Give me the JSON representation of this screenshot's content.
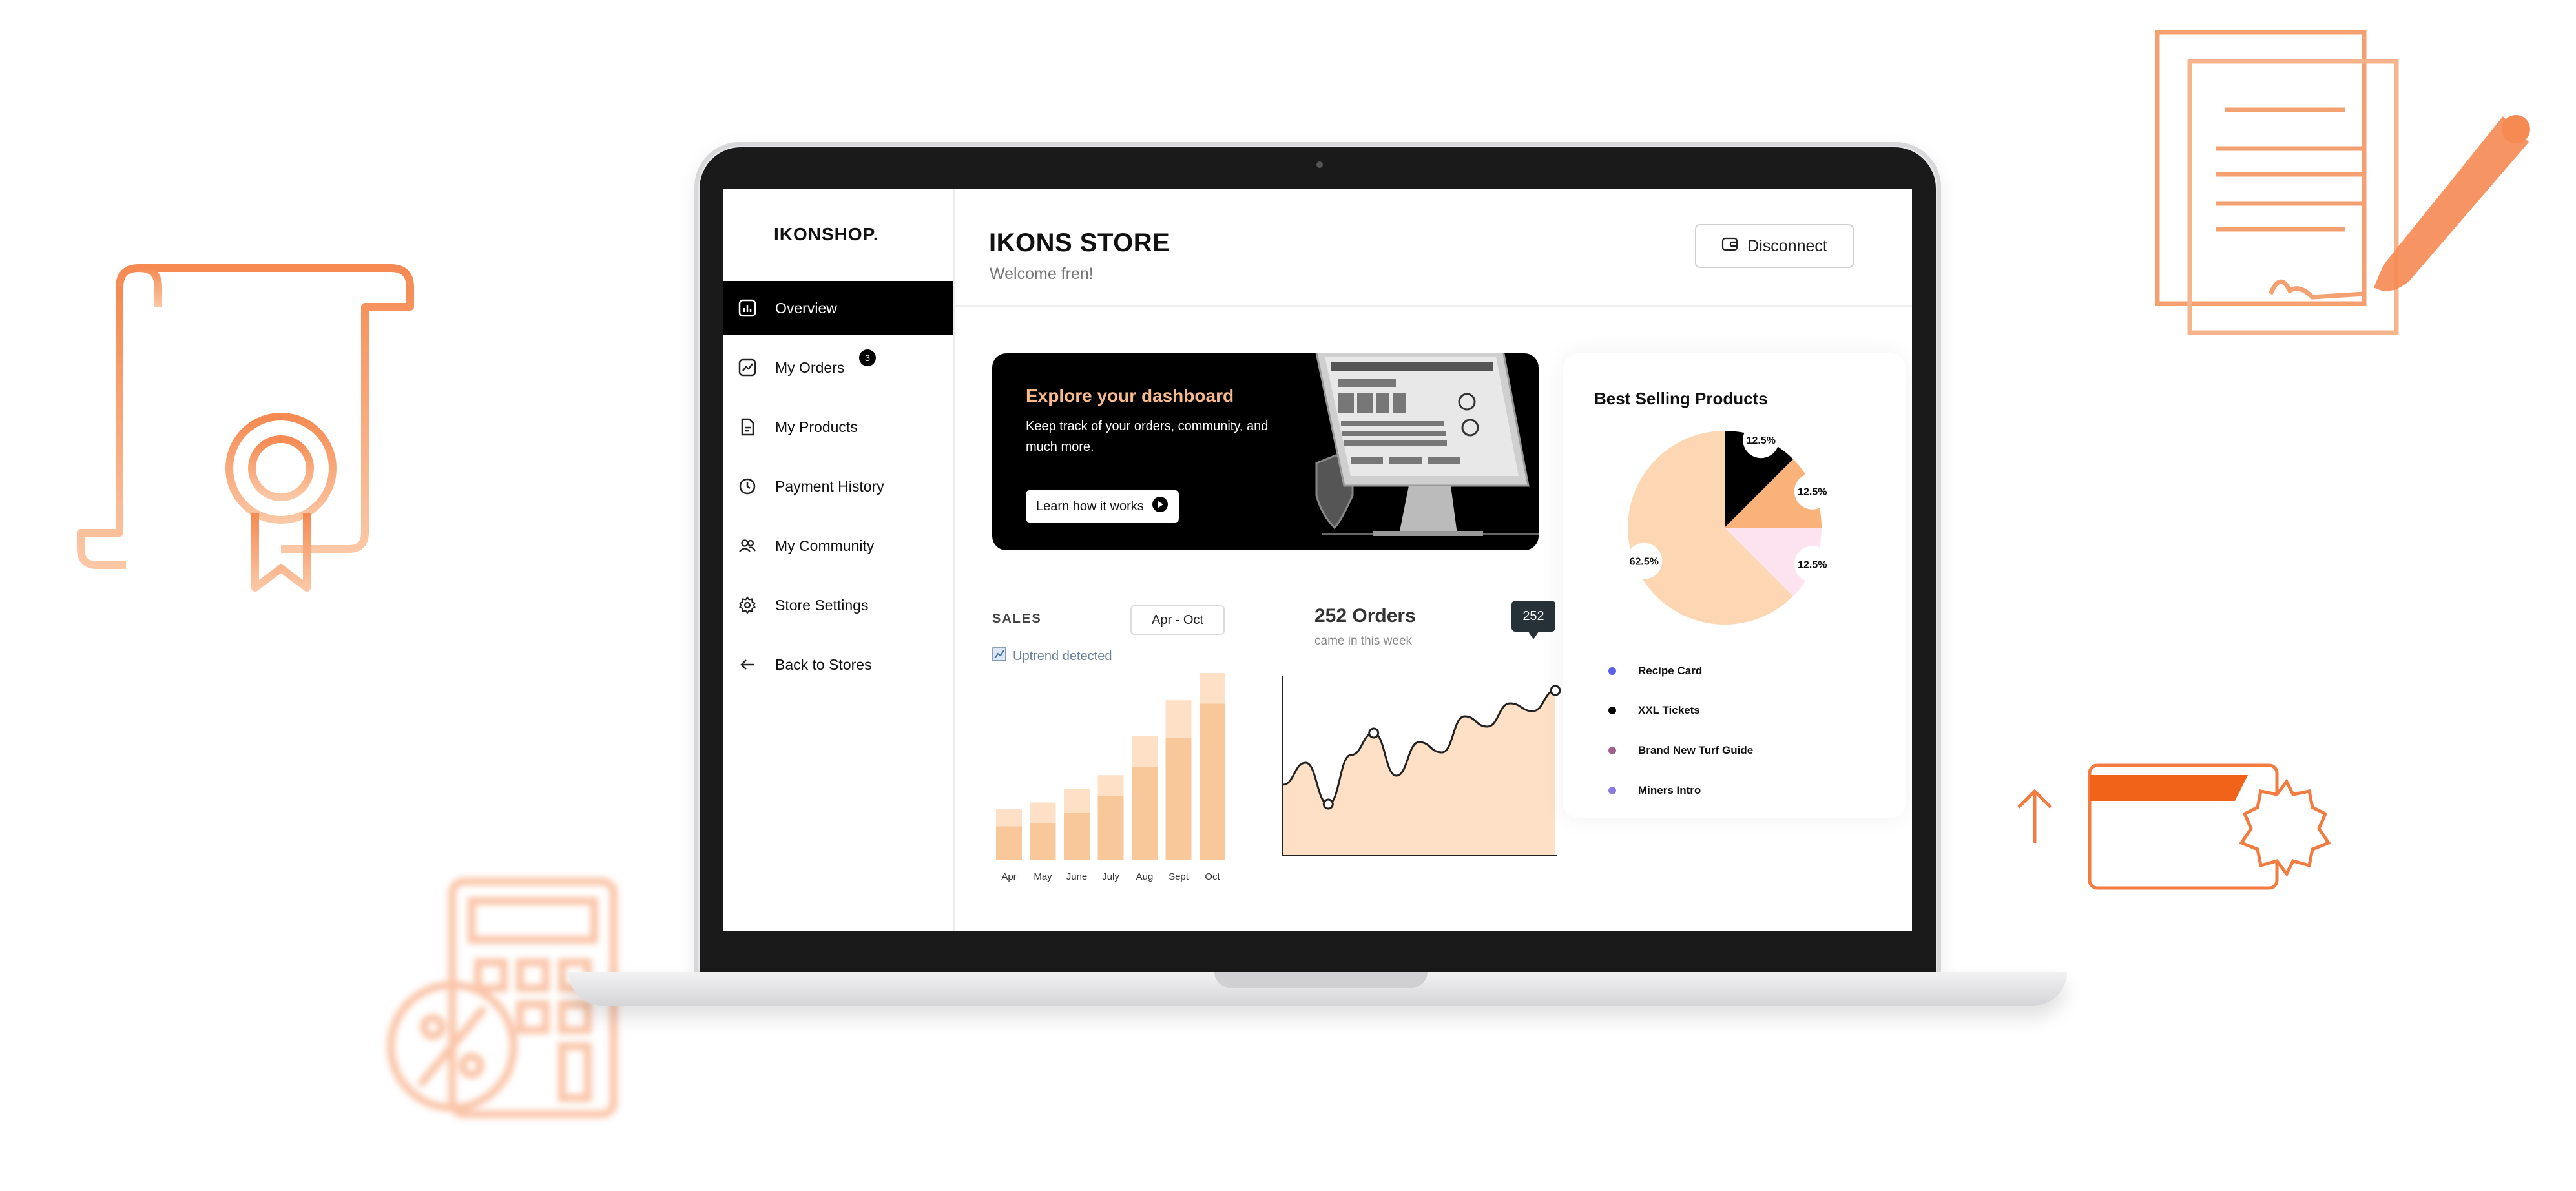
{
  "brand": {
    "logo": "IKONSHOP."
  },
  "header": {
    "title": "IKONS STORE",
    "subtitle": "Welcome fren!",
    "disconnect_label": "Disconnect"
  },
  "sidebar": {
    "items": [
      {
        "label": "Overview",
        "icon": "bar-chart-icon",
        "active": true
      },
      {
        "label": "My Orders",
        "icon": "trend-icon",
        "badge": "3"
      },
      {
        "label": "My Products",
        "icon": "document-icon"
      },
      {
        "label": "Payment History",
        "icon": "clock-icon"
      },
      {
        "label": "My Community",
        "icon": "users-icon"
      },
      {
        "label": "Store Settings",
        "icon": "gear-icon"
      },
      {
        "label": "Back to Stores",
        "icon": "arrow-left-icon"
      }
    ]
  },
  "banner": {
    "title": "Explore your dashboard",
    "text": "Keep track of your orders, community, and much more.",
    "button_label": "Learn how it works"
  },
  "sales": {
    "label": "SALES",
    "period": "Apr - Oct",
    "trend_text": "Uptrend detected"
  },
  "orders": {
    "title": "252 Orders",
    "subtitle": "came in this week",
    "tooltip": "252"
  },
  "best_selling": {
    "title": "Best Selling Products",
    "legend": [
      {
        "label": "Recipe Card",
        "color": "#5b5fe8"
      },
      {
        "label": "XXL Tickets",
        "color": "#000000"
      },
      {
        "label": "Brand New Turf Guide",
        "color": "#a0608e"
      },
      {
        "label": "Miners Intro",
        "color": "#8a7be0"
      }
    ]
  },
  "colors": {
    "accent_orange": "#f37b3f",
    "peach": "#fdd9b5",
    "peach_dark": "#f8c18f",
    "black": "#000000"
  },
  "chart_data": [
    {
      "type": "bar",
      "title": "SALES",
      "categories": [
        "Apr",
        "May",
        "June",
        "July",
        "Aug",
        "Sept",
        "Oct"
      ],
      "series": [
        {
          "values": [
            20,
            22,
            28,
            38,
            55,
            72,
            92
          ]
        },
        {
          "values": [
            10,
            12,
            14,
            12,
            18,
            22,
            18
          ]
        }
      ]
    },
    {
      "type": "area",
      "title": "252 Orders",
      "x": [
        0,
        1,
        2,
        3,
        4,
        5,
        6,
        7,
        8,
        9,
        10,
        11,
        12
      ],
      "values": [
        55,
        72,
        40,
        78,
        95,
        62,
        88,
        80,
        108,
        100,
        118,
        112,
        128
      ]
    },
    {
      "type": "pie",
      "title": "Best Selling Products",
      "labels": [
        "Recipe Card",
        "XXL Tickets",
        "Brand New Turf Guide",
        "Miners Intro"
      ],
      "values": [
        62.5,
        12.5,
        12.5,
        12.5
      ],
      "data_labels": [
        "62.5%",
        "12.5%",
        "12.5%",
        "12.5%"
      ]
    }
  ]
}
